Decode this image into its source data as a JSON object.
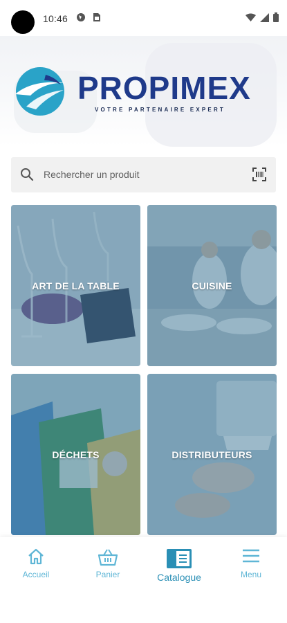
{
  "status_bar": {
    "time": "10:46",
    "icons": [
      "camera-cutout",
      "globe-icon",
      "sim-card-icon",
      "wifi-icon",
      "signal-icon",
      "battery-icon"
    ]
  },
  "header": {
    "brand": "PROPIMEX",
    "tagline": "VOTRE PARTENAIRE EXPERT",
    "logo_colors": [
      "#2aa3c8",
      "#1f3a8a"
    ]
  },
  "search": {
    "placeholder": "Rechercher un produit",
    "icons": [
      "search-icon",
      "barcode-scan-icon"
    ]
  },
  "categories": [
    {
      "label": "ART DE LA TABLE"
    },
    {
      "label": "CUISINE"
    },
    {
      "label": "DÉCHETS"
    },
    {
      "label": "DISTRIBUTEURS"
    }
  ],
  "bottom_nav": {
    "items": [
      {
        "label": "Accueil",
        "icon": "home-icon"
      },
      {
        "label": "Panier",
        "icon": "basket-icon"
      },
      {
        "label": "Catalogue",
        "icon": "catalog-icon",
        "active": true
      },
      {
        "label": "Menu",
        "icon": "menu-icon"
      }
    ],
    "color": "#5fb6d6",
    "active_color": "#2a8fb5"
  }
}
